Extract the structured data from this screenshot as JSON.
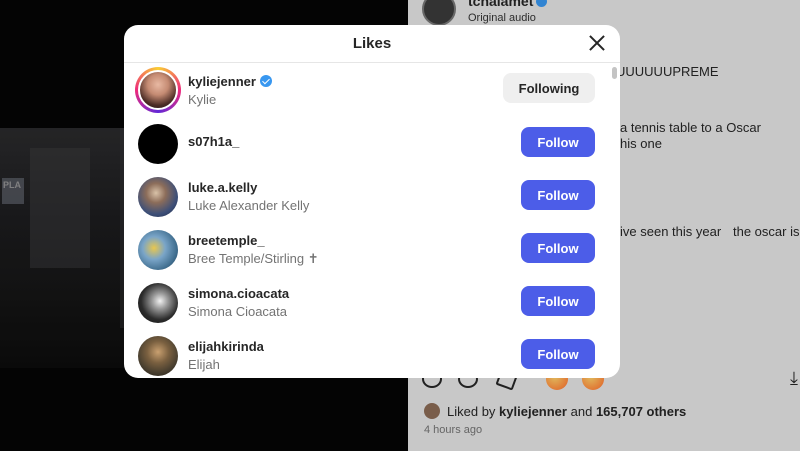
{
  "post": {
    "username": "tchalamet",
    "audio": "Original audio",
    "comments": [
      "UUUUUUPREME",
      "a tennis table to a Oscar",
      "his one",
      "ive seen this year",
      "the oscar is"
    ],
    "liked_by_prefix": "Liked by",
    "liked_by_user": "kyliejenner",
    "liked_by_and": "and",
    "liked_by_count": "165,707 others",
    "time": "4 hours ago",
    "download_icon": "download-icon"
  },
  "modal": {
    "title": "Likes",
    "close_icon": "close-icon",
    "users": [
      {
        "username": "kyliejenner",
        "fullname": "Kylie",
        "verified": true,
        "button": "Following",
        "avatar_color": "#6b4038"
      },
      {
        "username": "s07h1a_",
        "fullname": "",
        "verified": false,
        "button": "Follow",
        "avatar_color": "#000000"
      },
      {
        "username": "luke.a.kelly",
        "fullname": "Luke Alexander Kelly",
        "verified": false,
        "button": "Follow",
        "avatar_color": "#3d4f78"
      },
      {
        "username": "breetemple_",
        "fullname": "Bree Temple/Stirling ✝",
        "verified": false,
        "button": "Follow",
        "avatar_color": "#5e86a8"
      },
      {
        "username": "simona.cioacata",
        "fullname": "Simona Cioacata",
        "verified": false,
        "button": "Follow",
        "avatar_color": "#2c2c2c"
      },
      {
        "username": "elijahkirinda",
        "fullname": "Elijah",
        "verified": false,
        "button": "Follow",
        "avatar_color": "#4a4030"
      }
    ]
  },
  "colors": {
    "follow_button": "#4c5de8",
    "following_button": "#efefef",
    "verified_badge": "#3897f0"
  }
}
